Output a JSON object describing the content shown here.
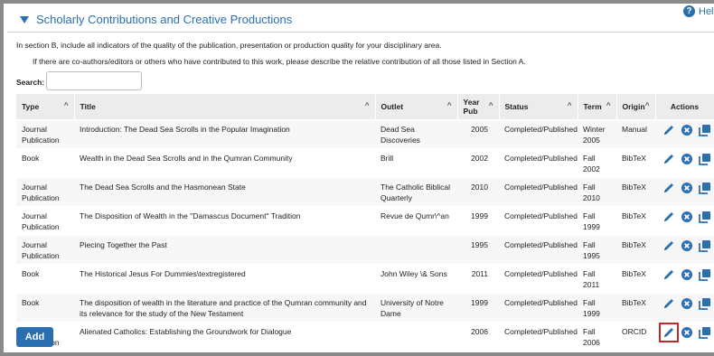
{
  "section": {
    "title": "Scholarly Contributions and Creative Productions",
    "help_label": "Help"
  },
  "instructions": {
    "line1": "In section B, include all indicators of the quality of the publication, presentation or production quality for your disciplinary area.",
    "line2": "If there are co-authors/editors or others who have contributed to this work, please describe the relative contribution of all those listed in Section A."
  },
  "search": {
    "label": "Search:",
    "value": ""
  },
  "table": {
    "columns": [
      "Type",
      "Title",
      "Outlet",
      "Year Pub",
      "Status",
      "Term",
      "Origin",
      "Actions"
    ],
    "rows": [
      {
        "type": "Journal Publication",
        "title": "Introduction: The Dead Sea Scrolls in the Popular Imagination",
        "outlet": "Dead Sea Discoveries",
        "year": "2005",
        "status": "Completed/Published",
        "term": "Winter 2005",
        "origin": "Manual"
      },
      {
        "type": "Book",
        "title": "Wealth in the Dead Sea Scrolls and in the Qumran Community",
        "outlet": "Brill",
        "year": "2002",
        "status": "Completed/Published",
        "term": "Fall 2002",
        "origin": "BibTeX"
      },
      {
        "type": "Journal Publication",
        "title": "The Dead Sea Scrolls and the Hasmonean State",
        "outlet": "The Catholic Biblical Quarterly",
        "year": "2010",
        "status": "Completed/Published",
        "term": "Fall 2010",
        "origin": "BibTeX"
      },
      {
        "type": "Journal Publication",
        "title": "The Disposition of Wealth in the \"Damascus Document\" Tradition",
        "outlet": "Revue de Qumr\\^an",
        "year": "1999",
        "status": "Completed/Published",
        "term": "Fall 1999",
        "origin": "BibTeX"
      },
      {
        "type": "Journal Publication",
        "title": "Piecing Together the Past",
        "outlet": "",
        "year": "1995",
        "status": "Completed/Published",
        "term": "Fall 1995",
        "origin": "BibTeX"
      },
      {
        "type": "Book",
        "title": "The Historical Jesus For Dummies\\textregistered",
        "outlet": "John Wiley \\& Sons",
        "year": "2011",
        "status": "Completed/Published",
        "term": "Fall 2011",
        "origin": "BibTeX"
      },
      {
        "type": "Book",
        "title": "The disposition of wealth in the literature and practice of the Qumran community and its relevance for the study of the New Testament",
        "outlet": "University of Notre Dame",
        "year": "1999",
        "status": "Completed/Published",
        "term": "Fall 1999",
        "origin": "BibTeX"
      },
      {
        "type": "Journal Publication",
        "title": "Alienated Catholics: Establishing the Groundwork for Dialogue",
        "outlet": "",
        "year": "2006",
        "status": "Completed/Published",
        "term": "Fall 2006",
        "origin": "ORCID"
      }
    ],
    "action_icons": [
      "pencil-icon",
      "delete-icon",
      "copy-icon"
    ]
  },
  "add_button": {
    "label": "Add"
  },
  "colors": {
    "accent": "#2a6fb0",
    "highlight": "#c62828"
  }
}
